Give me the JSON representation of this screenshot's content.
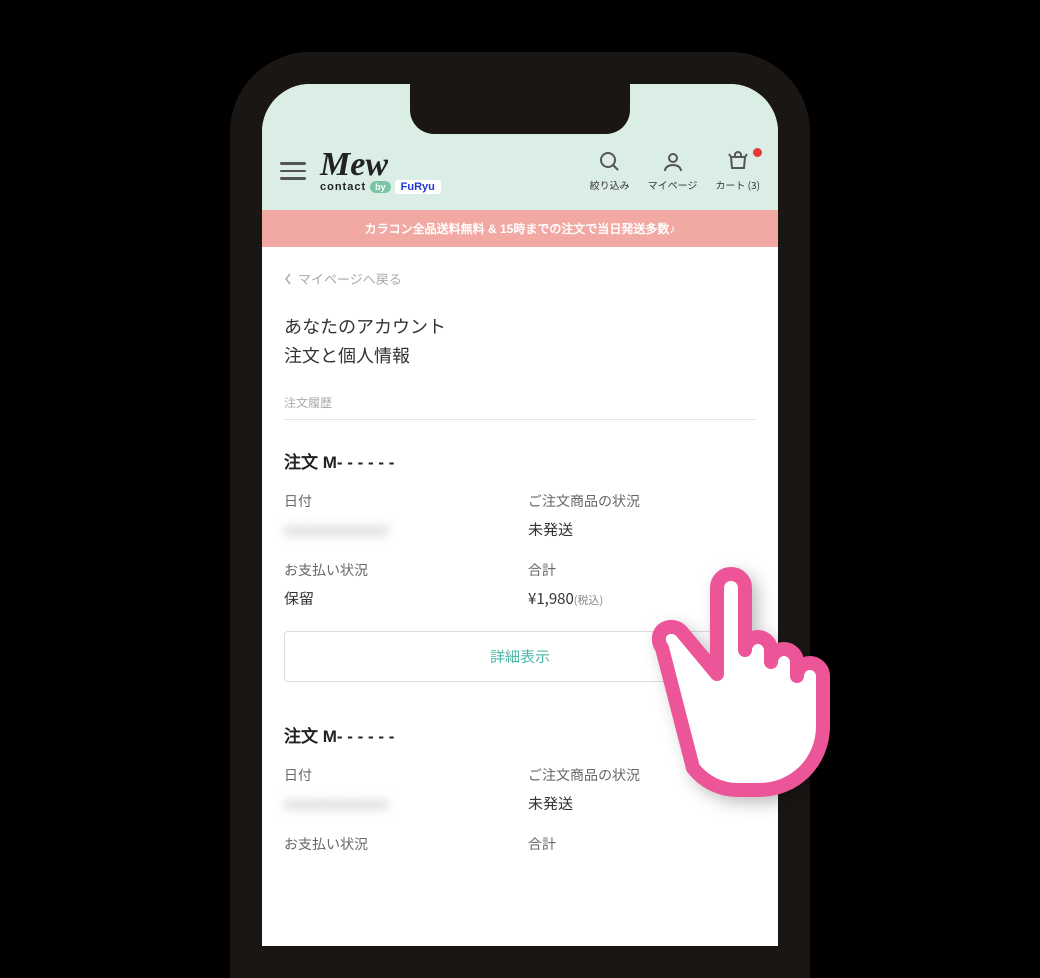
{
  "header": {
    "logo_main": "Mew",
    "logo_sub": "contact",
    "by": "by",
    "furyu": "FuRyu",
    "actions": {
      "search": "絞り込み",
      "mypage": "マイページ",
      "cart": "カート (3)"
    }
  },
  "banner": "カラコン全品送料無料 & 15時までの注文で当日発送多数♪",
  "back": "マイページへ戻る",
  "title1": "あなたのアカウント",
  "title2": "注文と個人情報",
  "section": "注文履歴",
  "labels": {
    "date": "日付",
    "status": "ご注文商品の状況",
    "pay": "お支払い状況",
    "total": "合計"
  },
  "orders": [
    {
      "id": "注文 M- - - - - -",
      "date": "xxxxxxxxxxxxxx",
      "status": "未発送",
      "pay": "保留",
      "total": "¥1,980",
      "tax": "(税込)",
      "detail": "詳細表示"
    },
    {
      "id": "注文 M- - - - - -",
      "date": "xxxxxxxxxxxxxx",
      "status": "未発送",
      "pay": "",
      "total": ""
    }
  ]
}
